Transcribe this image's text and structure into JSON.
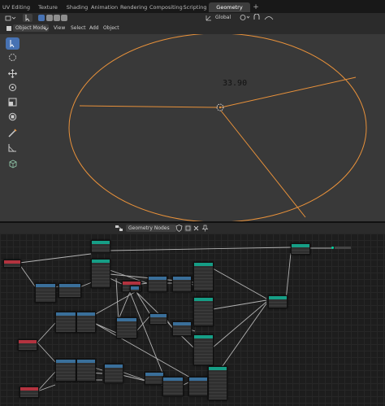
{
  "workspace_tabs": [
    {
      "label": "UV Editing",
      "active": false
    },
    {
      "label": "Texture Paint",
      "active": false
    },
    {
      "label": "Shading",
      "active": false
    },
    {
      "label": "Animation",
      "active": false
    },
    {
      "label": "Rendering",
      "active": false
    },
    {
      "label": "Compositing",
      "active": false
    },
    {
      "label": "Scripting",
      "active": false
    },
    {
      "label": "Geometry Nodes",
      "active": true
    }
  ],
  "add_workspace": "+",
  "viewport_header": {
    "mode": "Object Mode",
    "menus": [
      "View",
      "Select",
      "Add",
      "Object"
    ],
    "orientation": "Global"
  },
  "viewport": {
    "measure_text": "33.90"
  },
  "toolbar_tools": [
    "select-box-icon",
    "cursor-icon",
    "move-icon",
    "rotate-icon",
    "scale-icon",
    "transform-icon",
    "annotate-icon",
    "measure-icon",
    "add-cube-icon"
  ],
  "node_editor_header": {
    "tree_name": "Geometry Nodes"
  },
  "colors": {
    "accent": "#4772b3",
    "selection_orange": "#e8913a",
    "node_geometry": "#169e86",
    "node_vector": "#3a6f9a",
    "node_input": "#b3333f"
  },
  "nodes": [
    {
      "type": "geometry",
      "name": "group-input"
    },
    {
      "type": "input",
      "name": "value-input-1"
    },
    {
      "type": "vector",
      "name": "math-1"
    },
    {
      "type": "vector",
      "name": "math-2"
    },
    {
      "type": "geometry",
      "name": "curve-circle"
    },
    {
      "type": "input",
      "name": "value-input-2"
    },
    {
      "type": "vector",
      "name": "math-3"
    },
    {
      "type": "vector",
      "name": "math-4"
    },
    {
      "type": "geometry",
      "name": "mesh-line"
    },
    {
      "type": "vector",
      "name": "math-5"
    },
    {
      "type": "vector",
      "name": "math-6"
    },
    {
      "type": "vector",
      "name": "math-7"
    },
    {
      "type": "vector",
      "name": "math-8"
    },
    {
      "type": "geometry",
      "name": "transform-1"
    },
    {
      "type": "vector",
      "name": "math-9"
    },
    {
      "type": "geometry",
      "name": "transform-2"
    },
    {
      "type": "input",
      "name": "value-input-3"
    },
    {
      "type": "vector",
      "name": "math-10"
    },
    {
      "type": "vector",
      "name": "math-11"
    },
    {
      "type": "vector",
      "name": "math-12"
    },
    {
      "type": "geometry",
      "name": "transform-3"
    },
    {
      "type": "vector",
      "name": "math-13"
    },
    {
      "type": "geometry",
      "name": "join-geometry"
    },
    {
      "type": "input",
      "name": "value-input-4"
    },
    {
      "type": "vector",
      "name": "math-14"
    },
    {
      "type": "vector",
      "name": "math-15"
    },
    {
      "type": "vector",
      "name": "math-16"
    },
    {
      "type": "vector",
      "name": "math-17"
    },
    {
      "type": "vector",
      "name": "math-18"
    },
    {
      "type": "geometry",
      "name": "transform-4"
    },
    {
      "type": "geometry",
      "name": "group-output"
    }
  ]
}
